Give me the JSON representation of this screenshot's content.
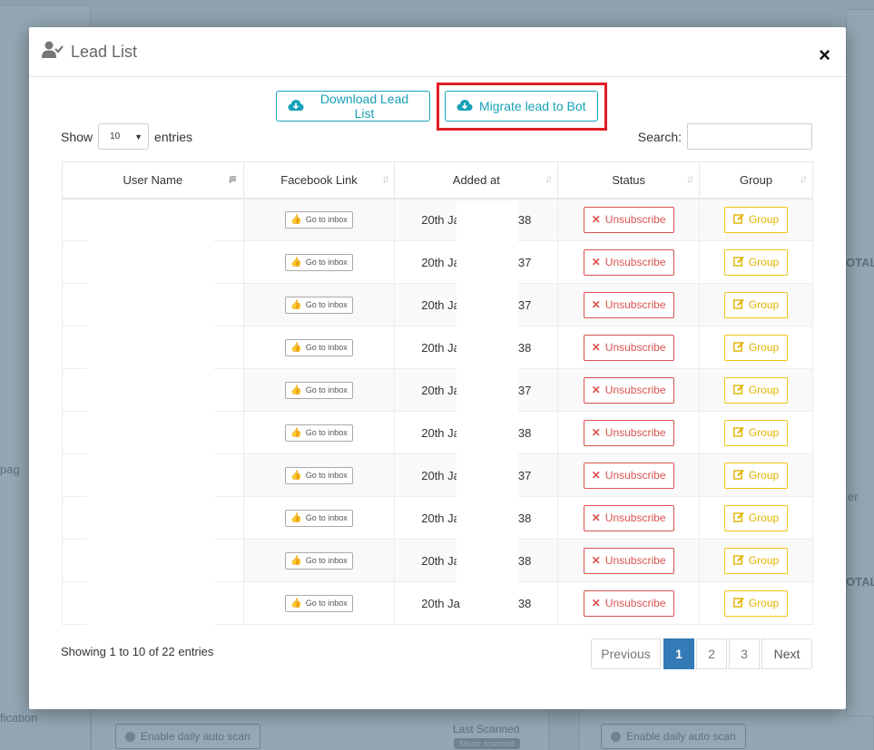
{
  "background": {
    "left_text_1": "pag",
    "left_text_2": "fication",
    "right_text_1": "OTAL",
    "right_text_2": "er",
    "right_text_3": "OTAL",
    "auto_scan_left": "Enable daily auto scan",
    "auto_scan_right": "Enable daily auto scan",
    "last_scanned": "Last Scanned",
    "never_scanned": "Never scanned"
  },
  "modal": {
    "title": "Lead List",
    "close_symbol": "×",
    "download_label": "Download Lead List",
    "migrate_label": "Migrate lead to Bot",
    "show_label": "Show",
    "entries_label": "entries",
    "page_size": "10",
    "search_label": "Search:",
    "search_value": ""
  },
  "table": {
    "headers": [
      "User Name",
      "Facebook Link",
      "Added at",
      "Status",
      "Group"
    ],
    "rows": [
      {
        "inbox": "Go to inbox",
        "added_prefix": "20th Ja",
        "added_suffix": "38",
        "status": "Unsubscribe",
        "group": "Group"
      },
      {
        "inbox": "Go to inbox",
        "added_prefix": "20th Ja",
        "added_suffix": "37",
        "status": "Unsubscribe",
        "group": "Group"
      },
      {
        "inbox": "Go to inbox",
        "added_prefix": "20th Ja",
        "added_suffix": "37",
        "status": "Unsubscribe",
        "group": "Group"
      },
      {
        "inbox": "Go to inbox",
        "added_prefix": "20th Ja",
        "added_suffix": "38",
        "status": "Unsubscribe",
        "group": "Group"
      },
      {
        "inbox": "Go to inbox",
        "added_prefix": "20th Ja",
        "added_suffix": "37",
        "status": "Unsubscribe",
        "group": "Group"
      },
      {
        "inbox": "Go to inbox",
        "added_prefix": "20th Ja",
        "added_suffix": "38",
        "status": "Unsubscribe",
        "group": "Group"
      },
      {
        "inbox": "Go to inbox",
        "added_prefix": "20th Ja",
        "added_suffix": "37",
        "status": "Unsubscribe",
        "group": "Group"
      },
      {
        "inbox": "Go to inbox",
        "added_prefix": "20th Ja",
        "added_suffix": "38",
        "status": "Unsubscribe",
        "group": "Group"
      },
      {
        "inbox": "Go to inbox",
        "added_prefix": "20th Ja",
        "added_suffix": "38",
        "status": "Unsubscribe",
        "group": "Group"
      },
      {
        "inbox": "Go to inbox",
        "added_prefix": "20th Ja",
        "added_suffix": "38",
        "status": "Unsubscribe",
        "group": "Group"
      }
    ]
  },
  "footer": {
    "info": "Showing 1 to 10 of 22 entries",
    "previous": "Previous",
    "pages": [
      "1",
      "2",
      "3"
    ],
    "active_page": "1",
    "next": "Next"
  },
  "colors": {
    "accent": "#17a2b8",
    "danger": "#d9534f",
    "warning": "#f0c419",
    "highlight": "#e01e25",
    "pagination_active": "#337ab7"
  }
}
